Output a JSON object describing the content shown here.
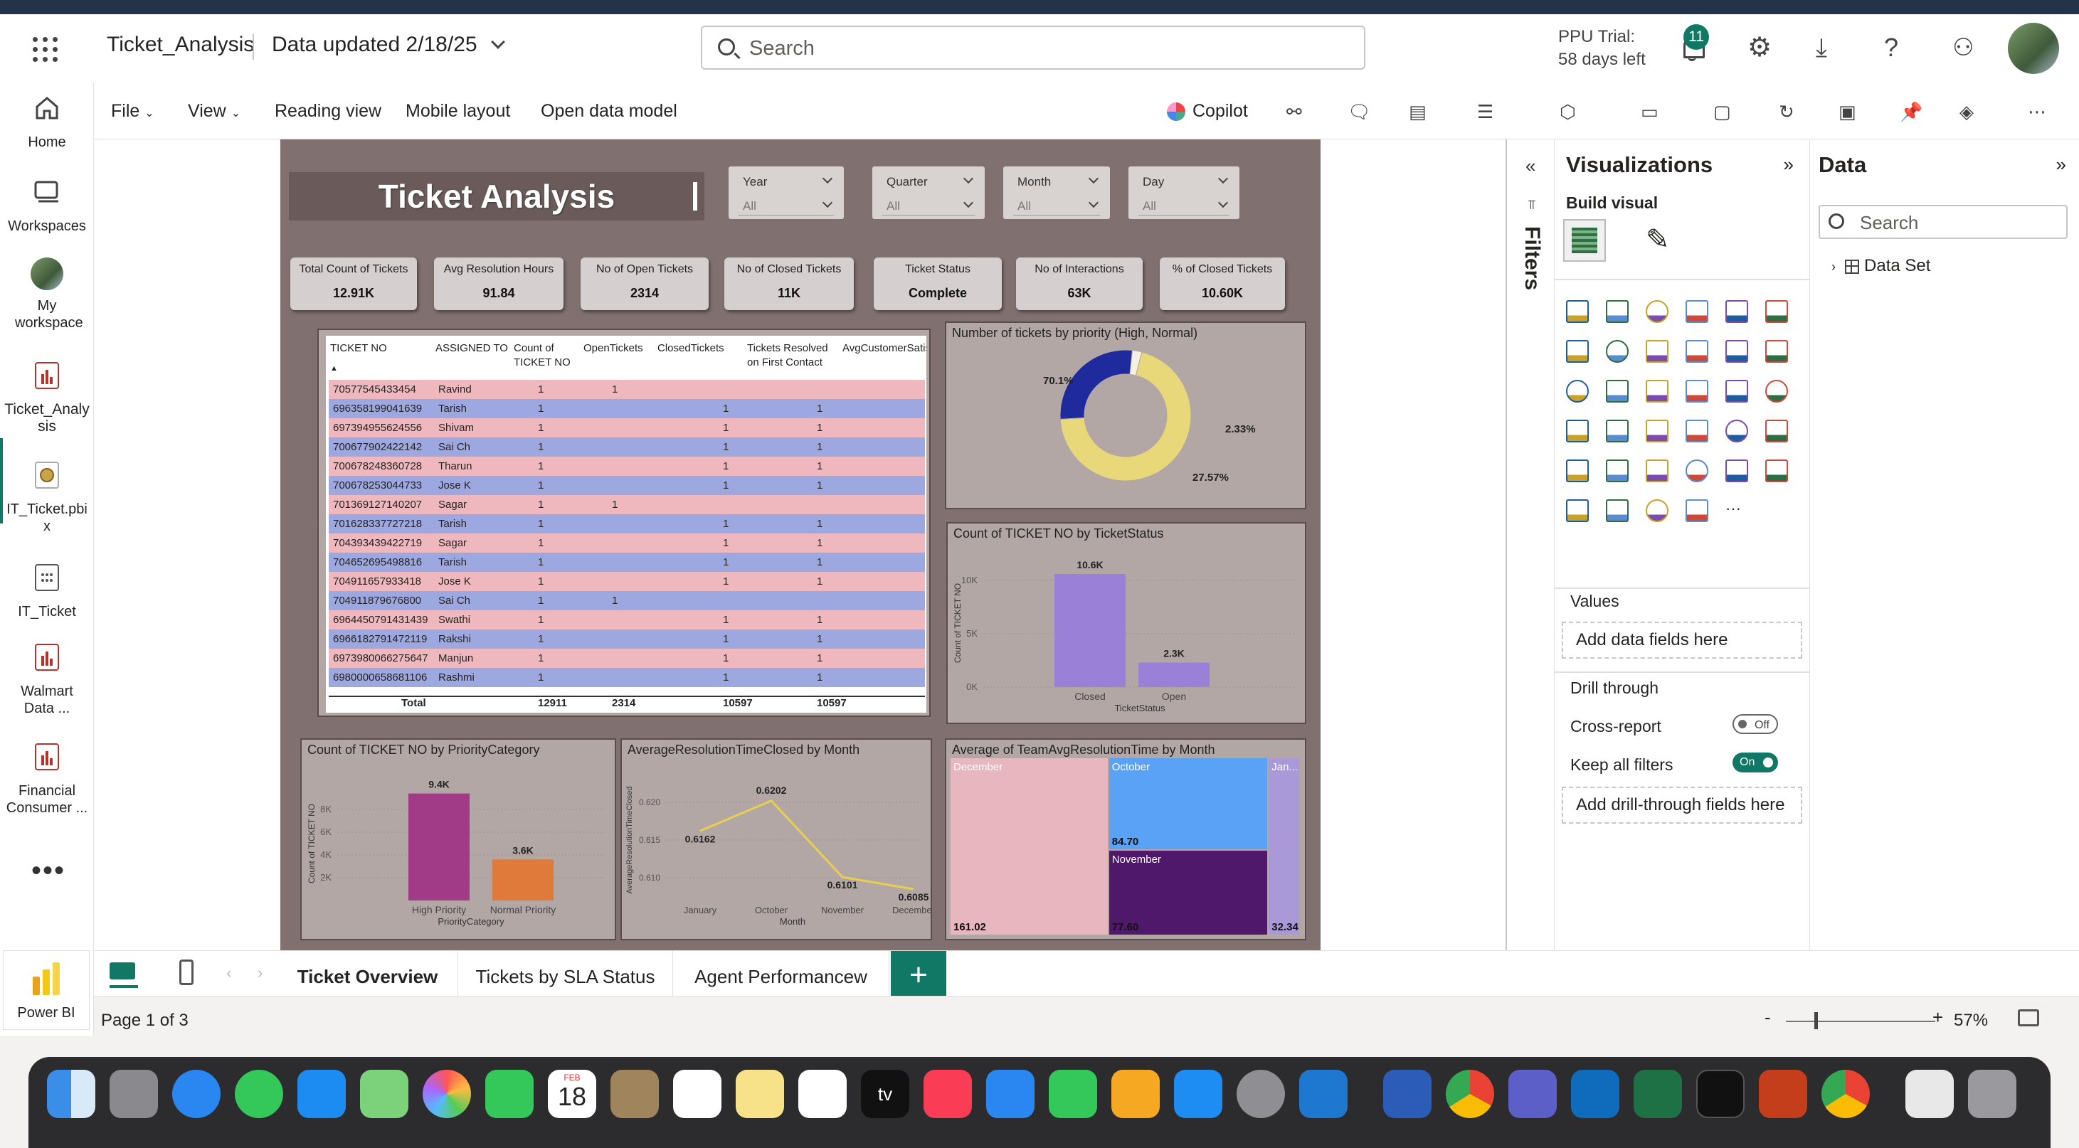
{
  "app": {
    "title": "Ticket_Analysis",
    "data_updated": "Data updated 2/18/25"
  },
  "search": {
    "placeholder": "Search"
  },
  "header": {
    "trial": "PPU Trial:",
    "trial_days": "58 days left",
    "notif_count": "11"
  },
  "leftnav": [
    {
      "label": "Home"
    },
    {
      "label": "Workspaces"
    },
    {
      "label": "My workspace"
    },
    {
      "label": "Ticket_Analysis"
    },
    {
      "label": "IT_Ticket.pbix"
    },
    {
      "label": "IT_Ticket"
    },
    {
      "label": "Walmart Data ..."
    },
    {
      "label": "Financial Consumer ..."
    }
  ],
  "leftnav_footer": "Power BI",
  "ribbon": {
    "file": "File",
    "view": "View",
    "reading": "Reading view",
    "mobile": "Mobile layout",
    "open_model": "Open data model",
    "copilot": "Copilot"
  },
  "report": {
    "title": "Ticket Analysis",
    "slicers": [
      {
        "label": "Year",
        "value": "All"
      },
      {
        "label": "Quarter",
        "value": "All"
      },
      {
        "label": "Month",
        "value": "All"
      },
      {
        "label": "Day",
        "value": "All"
      }
    ],
    "kpis": [
      {
        "label": "Total Count of Tickets",
        "value": "12.91K"
      },
      {
        "label": "Avg Resolution Hours",
        "value": "91.84"
      },
      {
        "label": "No of Open Tickets",
        "value": "2314"
      },
      {
        "label": "No of Closed Tickets",
        "value": "11K"
      },
      {
        "label": "Ticket Status",
        "value": "Complete"
      },
      {
        "label": "No of Interactions",
        "value": "63K"
      },
      {
        "label": "% of Closed Tickets",
        "value": "10.60K"
      }
    ],
    "table": {
      "headers": [
        "TICKET NO",
        "ASSIGNED TO",
        "Count of TICKET NO",
        "OpenTickets",
        "ClosedTickets",
        "Tickets Resolved on First Contact",
        "AvgCustomerSatis"
      ],
      "rows": [
        [
          "70577545433454",
          "Ravind",
          "1",
          "1",
          "",
          ""
        ],
        [
          "696358199041639",
          "Tarish",
          "1",
          "",
          "1",
          "1"
        ],
        [
          "697394955624556",
          "Shivam",
          "1",
          "",
          "1",
          "1"
        ],
        [
          "700677902422142",
          "Sai Ch",
          "1",
          "",
          "1",
          "1"
        ],
        [
          "700678248360728",
          "Tharun",
          "1",
          "",
          "1",
          "1"
        ],
        [
          "700678253044733",
          "Jose K",
          "1",
          "",
          "1",
          "1"
        ],
        [
          "701369127140207",
          "Sagar",
          "1",
          "1",
          "",
          ""
        ],
        [
          "701628337727218",
          "Tarish",
          "1",
          "",
          "1",
          "1"
        ],
        [
          "704393439422719",
          "Sagar",
          "1",
          "",
          "1",
          "1"
        ],
        [
          "704652695498816",
          "Tarish",
          "1",
          "",
          "1",
          "1"
        ],
        [
          "704911657933418",
          "Jose K",
          "1",
          "",
          "1",
          "1"
        ],
        [
          "704911879676800",
          "Sai Ch",
          "1",
          "1",
          "",
          ""
        ],
        [
          "6964450791431439",
          "Swathi",
          "1",
          "",
          "1",
          "1"
        ],
        [
          "6966182791472119",
          "Rakshi",
          "1",
          "",
          "1",
          "1"
        ],
        [
          "6973980066275647",
          "Manjun",
          "1",
          "",
          "1",
          "1"
        ],
        [
          "6980000658681106",
          "Rashmi",
          "1",
          "",
          "1",
          "1"
        ]
      ],
      "total": [
        "Total",
        "12911",
        "2314",
        "10597",
        "10597"
      ]
    }
  },
  "chart_data": [
    {
      "type": "pie",
      "title": "Number of tickets by priority (High, Normal)",
      "values": [
        70.1,
        27.57,
        2.33
      ],
      "labels": [
        "70.1%",
        "27.57%",
        "2.33%"
      ],
      "colors": [
        "#e8d87a",
        "#1f2a9c",
        "#f5f0e0"
      ]
    },
    {
      "type": "bar",
      "title": "Count of TICKET NO by TicketStatus",
      "categories": [
        "Closed",
        "Open"
      ],
      "values": [
        10600,
        2300
      ],
      "data_labels": [
        "10.6K",
        "2.3K"
      ],
      "xlabel": "TicketStatus",
      "ylabel": "Count of TICKET NO",
      "yticks": [
        "0K",
        "5K",
        "10K"
      ],
      "ylim": [
        0,
        12000
      ],
      "colors": [
        "#9b80d8",
        "#9b80d8"
      ]
    },
    {
      "type": "bar",
      "title": "Count of TICKET NO by PriorityCategory",
      "categories": [
        "High Priority",
        "Normal Priority"
      ],
      "values": [
        9400,
        3600
      ],
      "data_labels": [
        "9.4K",
        "3.6K"
      ],
      "xlabel": "PriorityCategory",
      "ylabel": "Count of TICKET NO",
      "yticks": [
        "2K",
        "4K",
        "6K",
        "8K"
      ],
      "ylim": [
        0,
        10000
      ],
      "colors": [
        "#a23b87",
        "#e07a3a"
      ]
    },
    {
      "type": "line",
      "title": "AverageResolutionTimeClosed by Month",
      "categories": [
        "January",
        "October",
        "November",
        "December"
      ],
      "values": [
        0.6162,
        0.6202,
        0.6101,
        0.6085
      ],
      "xlabel": "Month",
      "ylabel": "AverageResolutionTimeClosed",
      "yticks": [
        "0.610",
        "0.615",
        "0.620"
      ],
      "ylim": [
        0.607,
        0.623
      ],
      "color": "#e8cf50"
    },
    {
      "type": "treemap",
      "title": "Average of TeamAvgResolutionTime by Month",
      "items": [
        {
          "label": "December",
          "value": 161.02,
          "color": "#e7b6bf"
        },
        {
          "label": "October",
          "value": 84.7,
          "color": "#5aa2f5"
        },
        {
          "label": "November",
          "value": 77.6,
          "color": "#50186a"
        },
        {
          "label": "Jan...",
          "value": 32.34,
          "color": "#a999d8"
        }
      ],
      "value_labels": [
        "161.02",
        "84.70",
        "77.60",
        "32.34"
      ]
    }
  ],
  "viz": {
    "title": "Visualizations",
    "build": "Build visual",
    "values": "Values",
    "add_data": "Add data fields here",
    "drill": "Drill through",
    "cross": "Cross-report",
    "cross_state": "Off",
    "keep": "Keep all filters",
    "keep_state": "On",
    "add_drill": "Add drill-through fields here"
  },
  "filters_label": "Filters",
  "data": {
    "title": "Data",
    "search": "Search",
    "dataset": "Data Set"
  },
  "tabs": [
    "Ticket Overview",
    "Tickets by SLA Status",
    "Agent Performancew"
  ],
  "status": {
    "page": "Page 1 of 3",
    "zoom": "57%"
  },
  "dock": {
    "calendar_month": "FEB",
    "calendar_day": "18"
  }
}
